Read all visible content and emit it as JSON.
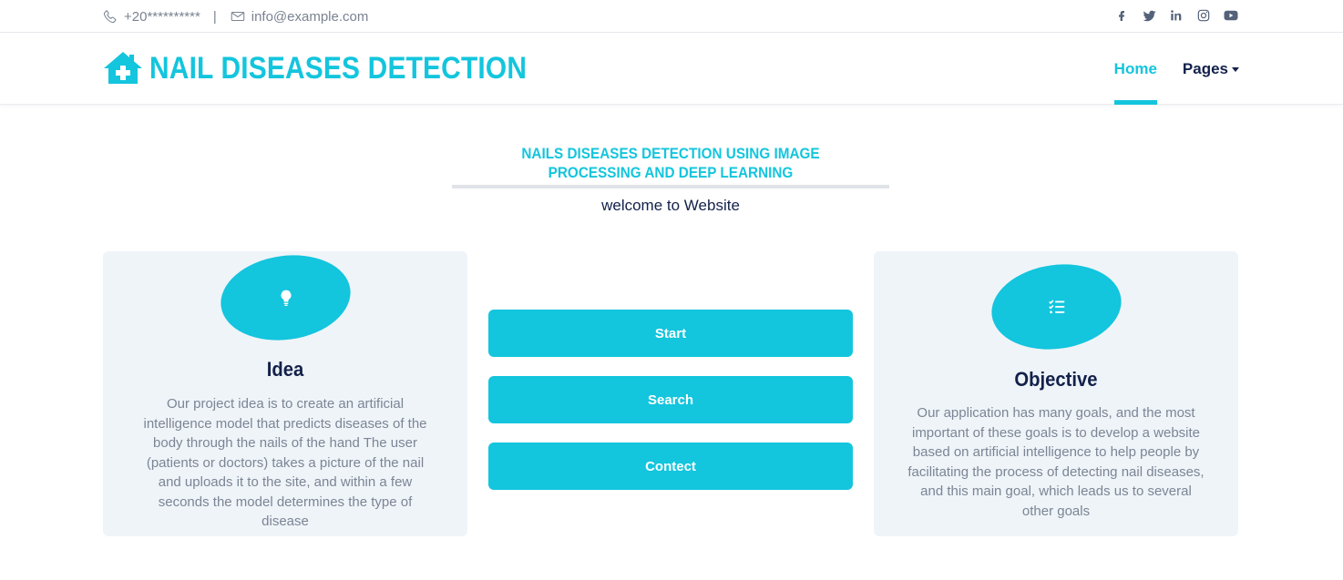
{
  "topbar": {
    "phone": "+20**********",
    "separator": "|",
    "email": "info@example.com",
    "social_icons": [
      "facebook-icon",
      "twitter-icon",
      "linkedin-icon",
      "instagram-icon",
      "youtube-icon"
    ]
  },
  "header": {
    "brand_title": "NAIL DISEASES DETECTION",
    "logo_icon": "hospital-house-icon",
    "nav": {
      "home": "Home",
      "pages": "Pages"
    }
  },
  "section": {
    "subtitle": "NAILS DISEASES DETECTION USING IMAGE PROCESSING AND DEEP LEARNING",
    "welcome": "welcome to Website"
  },
  "cards": {
    "idea": {
      "icon": "lightbulb-icon",
      "title": "Idea",
      "text": "Our project idea is to create an artificial intelligence model that predicts diseases of the body through the nails of the hand The user (patients or doctors) takes a picture of the nail and uploads it to the site, and within a few seconds the model determines the type of disease"
    },
    "objective": {
      "icon": "checklist-icon",
      "title": "Objective",
      "text": "Our application has many goals, and the most important of these goals is to develop a website based on artificial intelligence to help people by facilitating the process of detecting nail diseases, and this main goal, which leads us to several other goals"
    }
  },
  "buttons": {
    "start": "Start",
    "search": "Search",
    "contect": "Contect"
  },
  "colors": {
    "accent": "#13c5dd",
    "dark": "#13214a",
    "muted": "#7c8594",
    "card_bg": "#eff4f9"
  }
}
